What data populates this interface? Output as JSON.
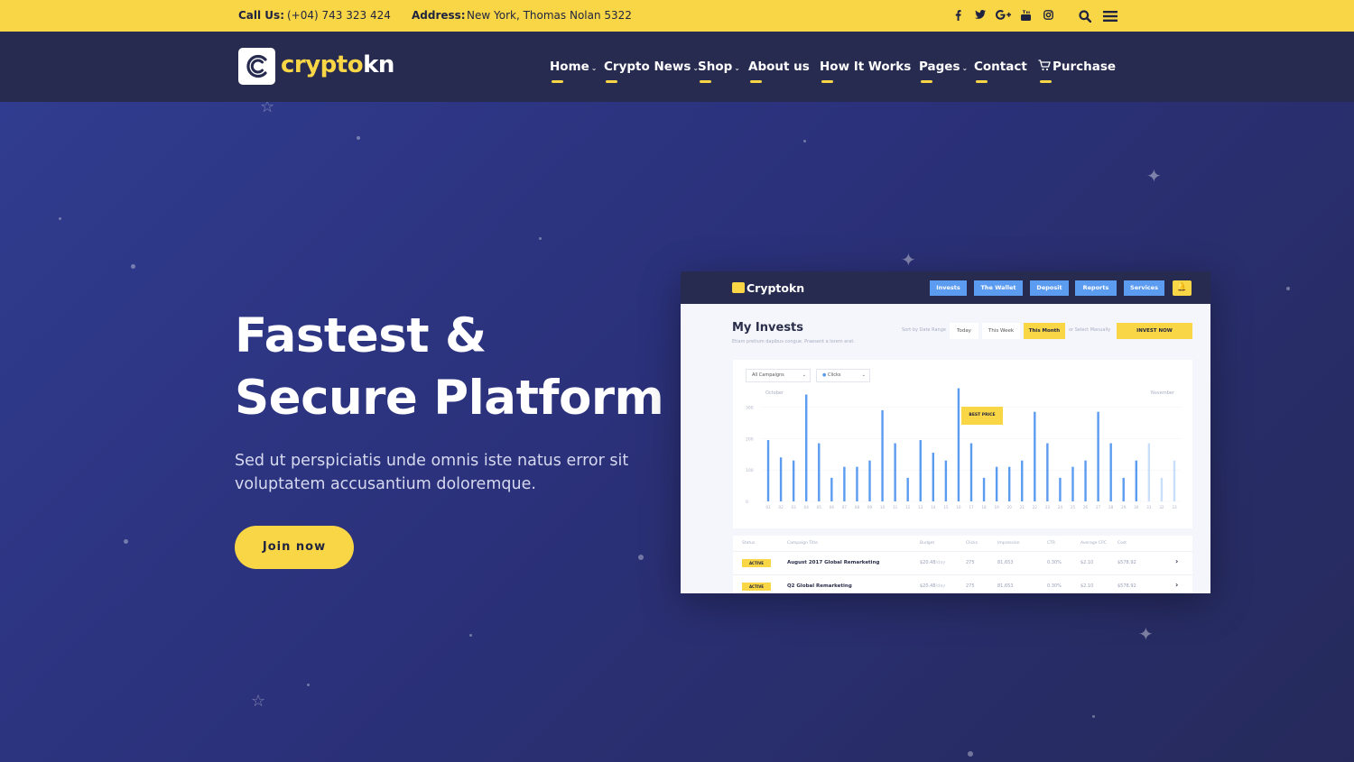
{
  "topbar": {
    "call_label": "Call Us:",
    "phone": "(+04) 743 323 424",
    "address_label": "Address:",
    "address": "New York, Thomas Nolan 5322",
    "social": [
      {
        "name": "facebook-icon",
        "glyph": "f"
      },
      {
        "name": "twitter-icon",
        "glyph": "t"
      },
      {
        "name": "google-plus-icon",
        "glyph": "G+"
      },
      {
        "name": "youtube-icon",
        "glyph": "yt"
      },
      {
        "name": "instagram-icon",
        "glyph": "ig"
      }
    ]
  },
  "nav": {
    "logo_part1": "crypto",
    "logo_part2": "kn",
    "items": [
      {
        "label": "Home",
        "dropdown": true
      },
      {
        "label": "Crypto News",
        "dropdown": true
      },
      {
        "label": "Shop",
        "dropdown": true
      },
      {
        "label": "About us",
        "dropdown": false
      },
      {
        "label": "How It Works",
        "dropdown": false
      },
      {
        "label": "Pages",
        "dropdown": true
      },
      {
        "label": "Contact",
        "dropdown": false
      },
      {
        "label": "Purchase",
        "dropdown": false
      }
    ]
  },
  "hero": {
    "title_line1": "Fastest &",
    "title_line2": "Secure Platform",
    "subtitle": "Sed ut perspiciatis unde omnis iste natus error sit voluptatem accusantium doloremque.",
    "cta_label": "Join now"
  },
  "dashboard": {
    "logo": "Cryptokn",
    "tabs": [
      "Invests",
      "The Wallet",
      "Deposit",
      "Reports",
      "Services"
    ],
    "title": "My Invests",
    "description": "Etiam pretium dapibus congue. Praesent a lorem erat.",
    "sort_label": "Sort by Date Range",
    "ranges": [
      "Today",
      "This Week",
      "This Month"
    ],
    "active_range": "This Month",
    "select_manually": "or Select Manually",
    "invest_button": "INVEST NOW",
    "campaign_select": "All Campaigns",
    "metric_select": "Clicks",
    "month_start": "October",
    "month_end": "November",
    "best_price_label": "BEST PRICE",
    "table": {
      "headers": [
        "Status",
        "Campaign Title",
        "Budget",
        "Clicks",
        "Impression",
        "CTR",
        "Average CPC",
        "Cost"
      ],
      "rows": [
        {
          "status": "ACTIVE",
          "title": "August 2017 Global Remarketing",
          "budget": "$20.48",
          "budget_unit": "/day",
          "clicks": "275",
          "impression": "81,653",
          "ctr": "0.30%",
          "cpc": "$2.10",
          "cost": "$578.92"
        },
        {
          "status": "ACTIVE",
          "title": "Q2 Global Remarketing",
          "budget": "$20.48",
          "budget_unit": "/day",
          "clicks": "275",
          "impression": "81,653",
          "ctr": "0.30%",
          "cpc": "$2.10",
          "cost": "$578.92"
        }
      ]
    }
  },
  "chart_data": {
    "type": "bar",
    "categories": [
      "01",
      "02",
      "03",
      "04",
      "05",
      "06",
      "07",
      "08",
      "09",
      "10",
      "11",
      "12",
      "13",
      "14",
      "15",
      "16",
      "17",
      "18",
      "19",
      "20",
      "21",
      "22",
      "23",
      "24",
      "25",
      "26",
      "27",
      "28",
      "29",
      "30",
      "31",
      "32",
      "33"
    ],
    "values": [
      195,
      140,
      130,
      340,
      185,
      75,
      110,
      110,
      130,
      290,
      185,
      75,
      195,
      155,
      130,
      360,
      185,
      75,
      110,
      110,
      130,
      285,
      185,
      75,
      110,
      130,
      285,
      185,
      75,
      130,
      185,
      75,
      130
    ],
    "faded_from_index": 30,
    "yticks": [
      "0",
      "100",
      "200",
      "300"
    ],
    "ylim": [
      0,
      330
    ],
    "bar_color": "#5b9bf0",
    "faded_color": "#c9defa"
  },
  "colors": {
    "accent": "#f9d646",
    "nav_bg": "#272b4f",
    "hero_bg": "#2b317a"
  }
}
